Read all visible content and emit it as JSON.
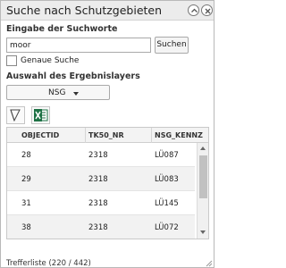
{
  "window": {
    "title": "Suche nach Schutzgebieten",
    "collapse_icon": "chevron-up-icon",
    "close_icon": "close-icon"
  },
  "search": {
    "section_label": "Eingabe der Suchworte",
    "input_value": "moor",
    "button_label": "Suchen",
    "exact_checkbox_label": "Genaue Suche",
    "exact_checked": false
  },
  "layer": {
    "section_label": "Auswahl des Ergebnislayers",
    "selected": "NSG"
  },
  "tools": {
    "select_icon": "draw-polygon-icon",
    "excel_icon": "excel-export-icon"
  },
  "results": {
    "columns": [
      "OBJECTID",
      "TK50_NR",
      "NSG_KENNZ"
    ],
    "rows": [
      [
        "28",
        "2318",
        "LÜ087"
      ],
      [
        "29",
        "2318",
        "LÜ083"
      ],
      [
        "31",
        "2318",
        "LÜ145"
      ],
      [
        "38",
        "2318",
        "LÜ072"
      ]
    ],
    "status": "Trefferliste (220 / 442)"
  },
  "colors": {
    "titlebar_bg": "#ececec",
    "row_alt_bg": "#f2f2f2",
    "excel_green": "#1e7145"
  }
}
